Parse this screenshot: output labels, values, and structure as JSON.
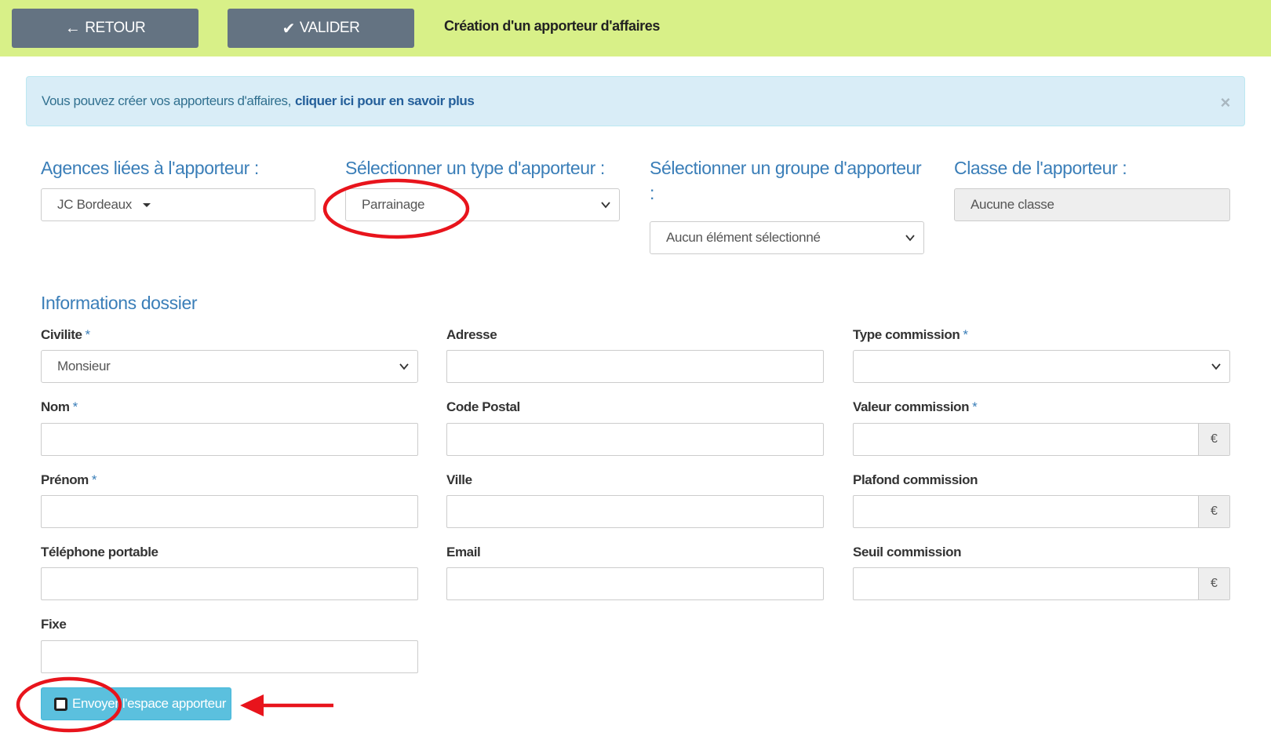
{
  "toolbar": {
    "back_label": "RETOUR",
    "validate_label": "VALIDER",
    "title": "Création d'un apporteur d'affaires"
  },
  "alert": {
    "text": "Vous pouvez créer vos apporteurs d'affaires,",
    "link": "cliquer ici pour en savoir plus",
    "close": "×"
  },
  "selectors": {
    "agencies_label": "Agences liées à l'apporteur :",
    "agencies_value": "JC Bordeaux",
    "type_label": "Sélectionner un type d'apporteur :",
    "type_value": "Parrainage",
    "group_label": "Sélectionner un groupe d'apporteur :",
    "group_value": "Aucun élément sélectionné",
    "class_label": "Classe de l'apporteur :",
    "class_value": "Aucune classe"
  },
  "form": {
    "section_title": "Informations dossier",
    "required_mark": "*",
    "civilite_label": "Civilite",
    "civilite_value": "Monsieur",
    "nom_label": "Nom",
    "prenom_label": "Prénom",
    "tel_label": "Téléphone portable",
    "fixe_label": "Fixe",
    "adresse_label": "Adresse",
    "cp_label": "Code Postal",
    "ville_label": "Ville",
    "email_label": "Email",
    "type_commission_label": "Type commission",
    "valeur_commission_label": "Valeur commission",
    "plafond_commission_label": "Plafond commission",
    "seuil_commission_label": "Seuil commission",
    "currency": "€"
  },
  "send_button": {
    "label": "Envoyer l'espace apporteur"
  },
  "colors": {
    "topbar": "#d8f088",
    "primary_text": "#3a7eb8",
    "annotation": "#e8141c"
  }
}
